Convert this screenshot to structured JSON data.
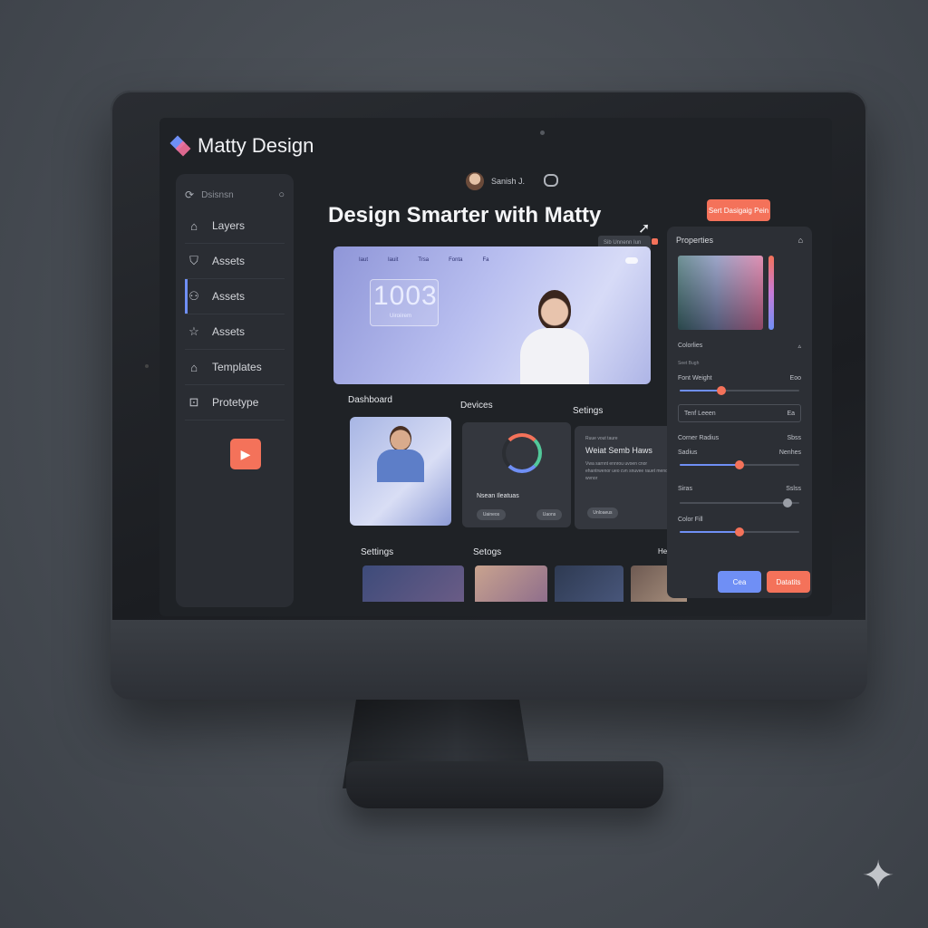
{
  "brand": {
    "name": "Matty Design"
  },
  "sidebar": {
    "search_label": "Dsisnsn",
    "items": [
      {
        "label": "Layers",
        "icon": "home-icon"
      },
      {
        "label": "Assets",
        "icon": "shield-icon"
      },
      {
        "label": "Assets",
        "icon": "person-icon"
      },
      {
        "label": "Assets",
        "icon": "star-icon"
      },
      {
        "label": "Templates",
        "icon": "template-icon"
      },
      {
        "label": "Protetype",
        "icon": "lock-icon"
      }
    ]
  },
  "topbar": {
    "user_name": "Sanish J.",
    "cta_label": "Sert Dasigaig Pein"
  },
  "main": {
    "headline": "Design Smarter with Matty",
    "mini_input": "Sib Unnenn Iun",
    "hero": {
      "nav": [
        "Iaut",
        "Iauit",
        "Trsa",
        "Fonta",
        "Fa"
      ],
      "stat": "1003",
      "stat_sub": "Uiroiirem"
    },
    "sections": {
      "row1": [
        "Dashboard",
        "Devices",
        "Setings"
      ],
      "row2": [
        "Settings",
        "Setogs",
        "Heatibs"
      ]
    },
    "cards": {
      "devices_title": "Nsean Ileatuas",
      "devices_btn_1": "Uaineos",
      "devices_btn_2": "Uaons",
      "settings_kicker": "Ruue vout taure",
      "settings_title": "Weiat Semb Haws",
      "settings_text": "Vwa sarnnt ennrou uvoen cnor ehantrwenor ueo cvn snuvee rauet meno wvnor",
      "settings_btn": "Unloaeus"
    },
    "thumbs": [
      {
        "color_a": "#3d4b7a",
        "color_b": "#6a5c86"
      },
      {
        "color_a": "#c9a38e",
        "color_b": "#8f6e8c"
      },
      {
        "color_a": "#2e3a52",
        "color_b": "#48567a"
      },
      {
        "color_a": "#6e5a52",
        "color_b": "#a8907e"
      }
    ]
  },
  "properties": {
    "title": "Properties",
    "colors_label": "Colorlies",
    "kicker": "Seet Bugh",
    "font_weight_label": "Font Weight",
    "font_weight_value": "Eoo",
    "font_weight_level": 0.35,
    "field_label": "Tenf Leeen",
    "field_value": "Ea",
    "corner_label": "Corner Radius",
    "corner_value": "Sbss",
    "row_a_label": "Sadius",
    "row_a_value": "Nenhes",
    "row_a_level": 0.5,
    "row_b_label": "Siras",
    "row_b_value": "Sslss",
    "row_b_level": 0.9,
    "row_c_label": "Color Fill",
    "row_c_level": 0.5,
    "btn_cancel": "Cea",
    "btn_ok": "Datatits"
  },
  "colors": {
    "accent_blue": "#6f8ff5",
    "accent_coral": "#f4725a",
    "panel": "#2c2f35"
  }
}
